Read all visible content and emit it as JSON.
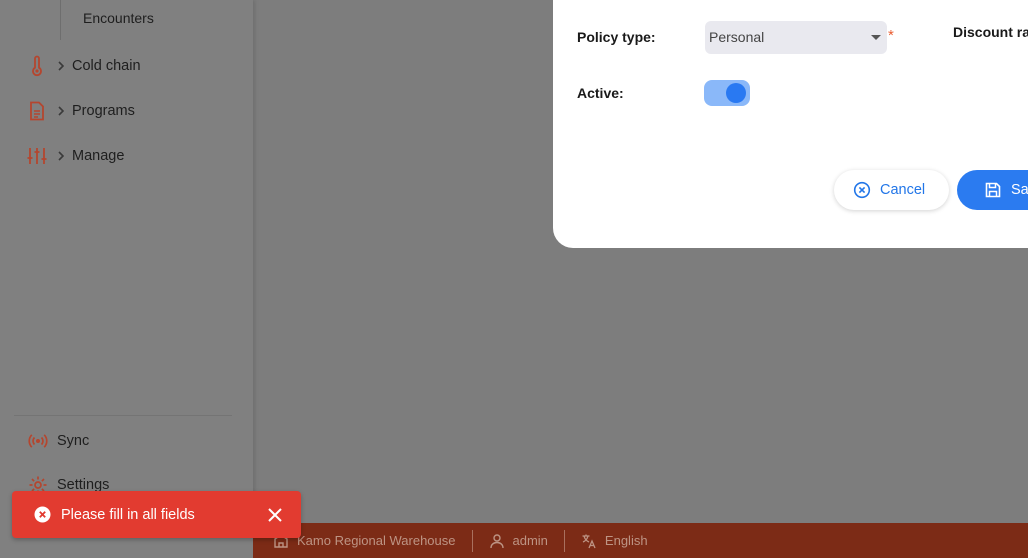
{
  "sidebar": {
    "subitem_label": "Encounters",
    "items": [
      {
        "label": "Cold chain",
        "icon": "thermometer-icon"
      },
      {
        "label": "Programs",
        "icon": "document-icon"
      },
      {
        "label": "Manage",
        "icon": "sliders-icon"
      }
    ],
    "footer": [
      {
        "label": "Sync",
        "icon": "broadcast-icon"
      },
      {
        "label": "Settings",
        "icon": "gear-icon"
      }
    ],
    "icon_color": "#b4462f"
  },
  "modal": {
    "policy_type_label": "Policy type:",
    "policy_type_value": "Personal",
    "required_marker": "*",
    "discount_label": "Discount ra",
    "active_label": "Active:",
    "active": true,
    "cancel_label": "Cancel",
    "save_label": "Sa"
  },
  "status_bar": {
    "store": "Kamo Regional Warehouse",
    "user": "admin",
    "language": "English"
  },
  "toast": {
    "message": "Please fill in all fields",
    "color": "#e23b30"
  },
  "colors": {
    "accent": "#2b7bf0",
    "status_bar": "#7c2b16"
  }
}
